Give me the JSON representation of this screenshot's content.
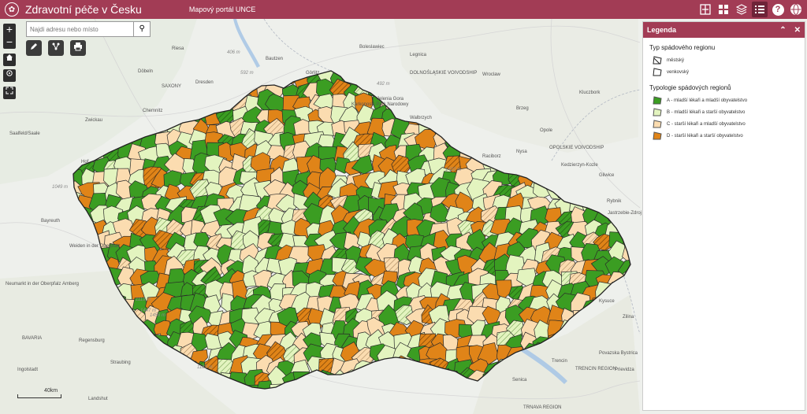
{
  "header": {
    "app_title": "Zdravotní péče v Česku",
    "subtitle": "Mapový portál UNCE",
    "help_symbol": "?",
    "tool_icons": [
      "layout-split-icon",
      "grid-icon",
      "layers-icon",
      "legend-list-icon",
      "help-icon",
      "globe-icon"
    ]
  },
  "search": {
    "placeholder": "Najdi adresu nebo místo"
  },
  "map_controls": {
    "zoom_in": "+",
    "zoom_out": "−"
  },
  "map": {
    "places": [
      "Riesa",
      "Bautzen",
      "Boleslawiec",
      "Legnica",
      "Dresden",
      "DOLNOŚLĄSKIE VOIVODSHIP",
      "Döbeln",
      "SAXONY",
      "Görlitz",
      "Wroclaw",
      "Jelenia Gora",
      "Karkonoski Park Narodowy",
      "Kluczbork",
      "Chemnitz",
      "Walbrzych",
      "Brzeg",
      "Zwickau",
      "Opole",
      "Saalfeld/Saale",
      "Raciborz",
      "Nysa",
      "OPOLSKIE VOIVODSHIP",
      "Kedzierzyn-Kozle",
      "Gliwice",
      "Hof",
      "Rybnik",
      "Jastrzebie-Zdroj",
      "Bayreuth",
      "Weiden in der Oberpfalz",
      "Neumarkt in der Oberpfalz",
      "Amberg",
      "Zilina",
      "BAVARIA",
      "Regensburg",
      "Ingolstadt",
      "Straubing",
      "Landshut",
      "Linz",
      "Trencin",
      "TRENCIN REGION",
      "Povazska Bystrica",
      "Prievidza",
      "Senica",
      "TRNAVA REGION",
      "LOWER AUSTRIA",
      "Kysuce",
      "Passau"
    ],
    "elevations": [
      "406 m",
      "592 m",
      "492 m",
      "1422 m",
      "1049 m",
      "1119 m",
      "1447 m",
      "1456 m",
      "1183 m"
    ],
    "scale_label": "40km"
  },
  "legend": {
    "title": "Legenda",
    "section1_title": "Typ spádového regionu",
    "section1_items": [
      "městský",
      "venkovský"
    ],
    "section2_title": "Typologie spádových regionů",
    "section2_items": [
      {
        "label": "A - mladší lékaři a mladší obyvatelstvo",
        "color": "#3b9d22"
      },
      {
        "label": "B - mladší lékaři a starší obyvatelstvo",
        "color": "#e3f4bf"
      },
      {
        "label": "C - starší lékaři a mladší obyvatelstvo",
        "color": "#fbdcb0"
      },
      {
        "label": "D - starší lékaři a starší obyvatelstvo",
        "color": "#e08418"
      }
    ],
    "collapse_icon": "chevron-double-up-icon",
    "close_icon": "close-icon"
  },
  "colors": {
    "header": "#a23c55",
    "A": "#3b9d22",
    "B": "#e3f4bf",
    "C": "#fbdcb0",
    "D": "#e08418"
  }
}
